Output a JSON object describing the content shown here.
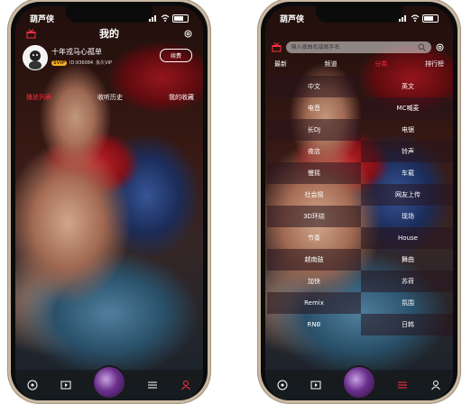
{
  "status": {
    "app_name": "葫芦侠"
  },
  "left": {
    "title": "我的",
    "profile": {
      "username": "十年戎马心孤单",
      "vip_badge": "SVIP",
      "id_text": "ID:936084",
      "vip_text": "永久VIP",
      "renew_label": "续费"
    },
    "quick_links": [
      "播放列表",
      "收听历史",
      "我的收藏"
    ]
  },
  "right": {
    "search_placeholder": "输入歌曲名或歌手名",
    "tabs": [
      "最新",
      "频道",
      "分类",
      "排行榜"
    ],
    "active_tab": 2,
    "categories": [
      "中文",
      "英文",
      "电音",
      "MC喊麦",
      "长DJ",
      "电锯",
      "夜店",
      "铃声",
      "慢摇",
      "车载",
      "社会摇",
      "网友上传",
      "3D环绕",
      "现场",
      "节奏",
      "House",
      "越南鼓",
      "舞曲",
      "加快",
      "苏荷",
      "Remix",
      "氛围",
      "RNB",
      "日韩"
    ]
  },
  "icons": {
    "nav": [
      "music-disc-icon",
      "video-icon",
      "player-disc",
      "menu-icon",
      "user-icon"
    ]
  },
  "colors": {
    "accent": "#ff2a3a"
  }
}
